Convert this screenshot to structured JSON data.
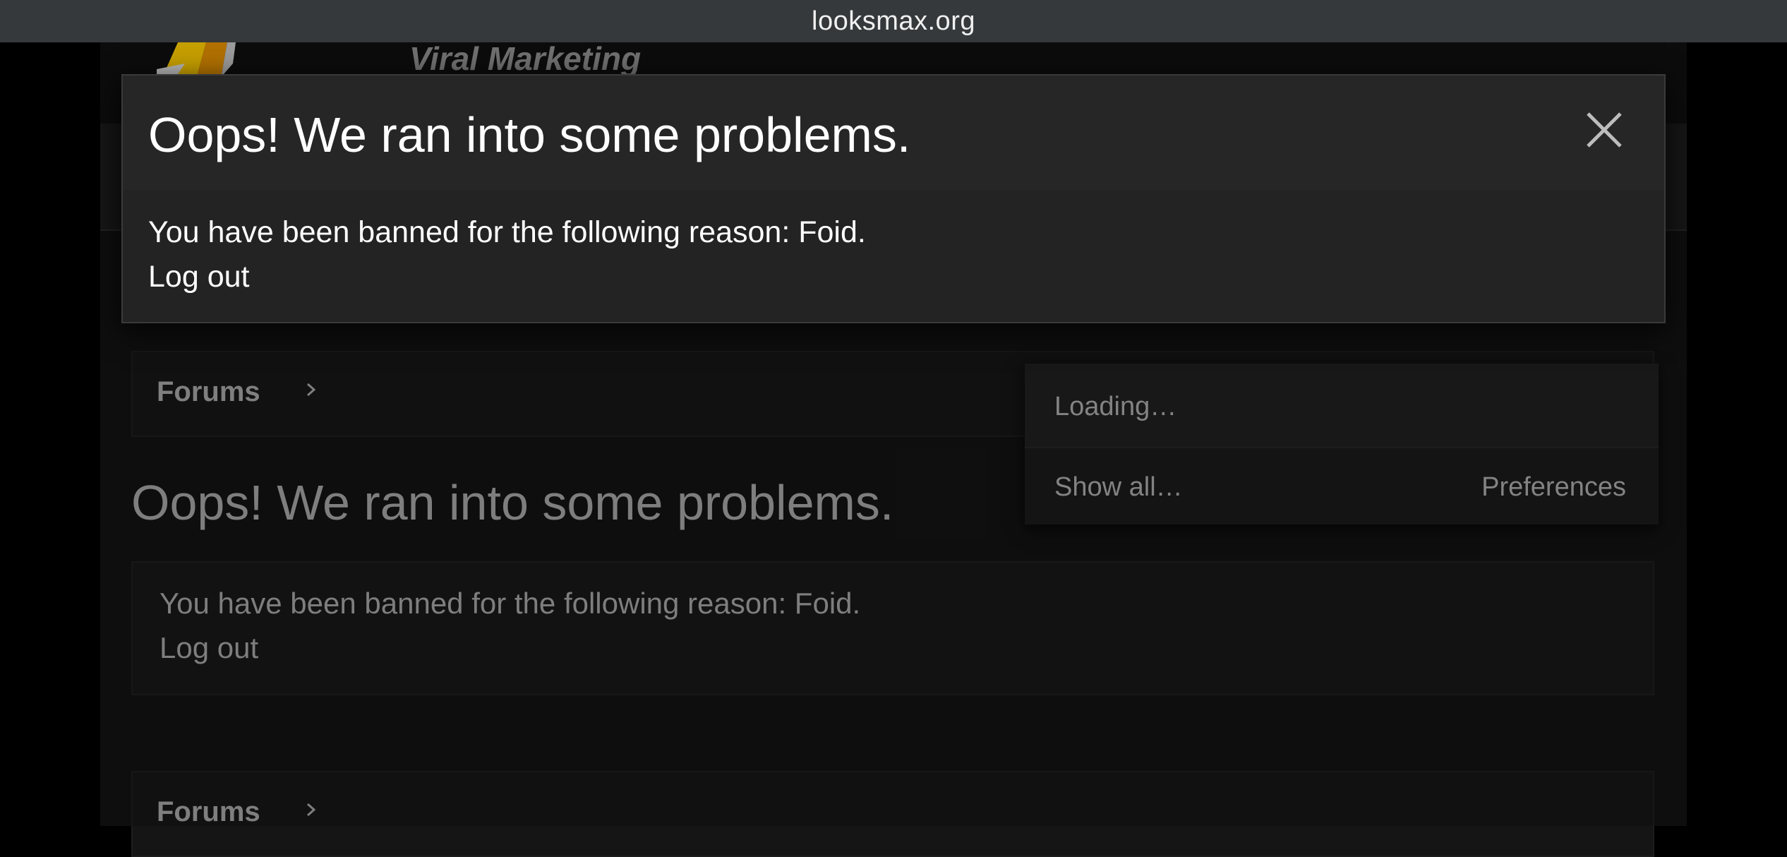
{
  "browser": {
    "url": "looksmax.org"
  },
  "header": {
    "tagline": "Viral Marketing"
  },
  "breadcrumbs": [
    {
      "label": "Forums"
    },
    {
      "label": "Forums"
    }
  ],
  "page": {
    "title": "Oops! We ran into some problems.",
    "message": "You have been banned for the following reason: Foid.",
    "logout": "Log out"
  },
  "alerts_menu": {
    "loading": "Loading…",
    "show_all": "Show all…",
    "preferences": "Preferences"
  },
  "modal": {
    "title": "Oops! We ran into some problems.",
    "message": "You have been banned for the following reason: Foid.",
    "logout": "Log out",
    "close_icon": "close-icon"
  },
  "colors": {
    "urlbar": "#35393c",
    "modal_bg": "#232323",
    "logo_yellow": "#f2c200",
    "logo_orange": "#d98a00"
  }
}
